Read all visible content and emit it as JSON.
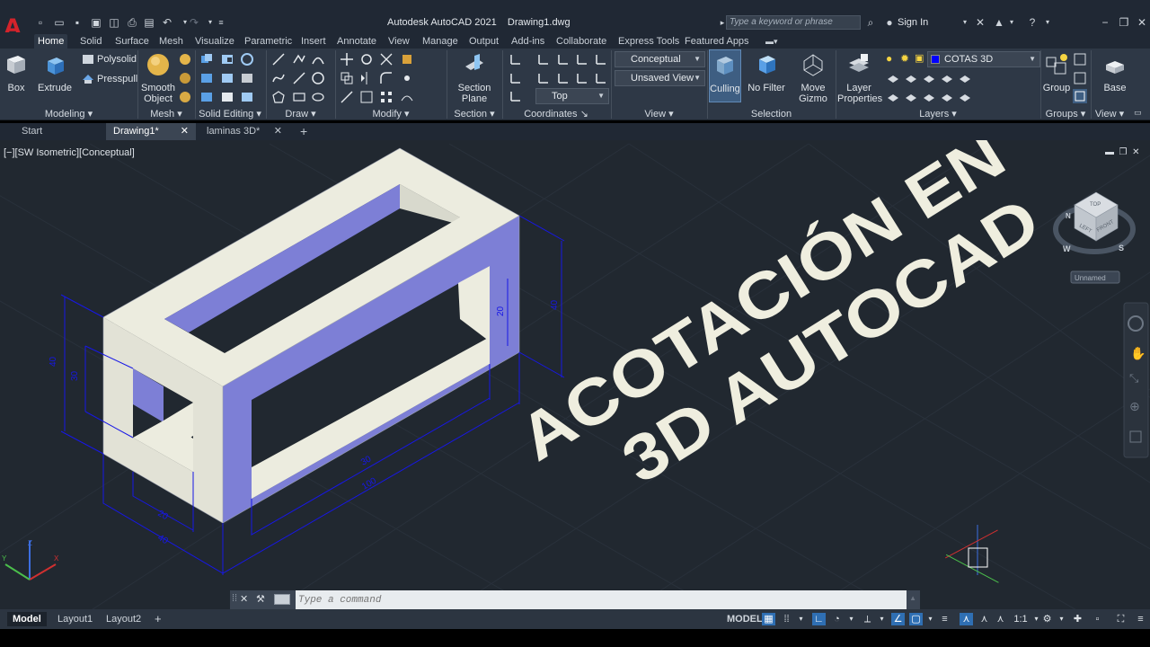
{
  "app": {
    "title": "Autodesk AutoCAD 2021    Drawing1.dwg",
    "search_placeholder": "Type a keyword or phrase",
    "sign_in": "Sign In",
    "logo": "A"
  },
  "ribbon_tabs": [
    "Home",
    "Solid",
    "Surface",
    "Mesh",
    "Visualize",
    "Parametric",
    "Insert",
    "Annotate",
    "View",
    "Manage",
    "Output",
    "Add-ins",
    "Collaborate",
    "Express Tools",
    "Featured Apps"
  ],
  "ribbon": {
    "modeling": {
      "title": "Modeling",
      "box": "Box",
      "extrude": "Extrude",
      "polysolid": "Polysolid",
      "presspull": "Presspull"
    },
    "mesh": {
      "title": "Mesh",
      "smooth": "Smooth",
      "object": "Object"
    },
    "solid_editing": {
      "title": "Solid Editing"
    },
    "draw": {
      "title": "Draw"
    },
    "modify": {
      "title": "Modify"
    },
    "section": {
      "title": "Section",
      "plane_1": "Section",
      "plane_2": "Plane"
    },
    "coordinates": {
      "title": "Coordinates",
      "view_select": "Top"
    },
    "view": {
      "title": "View",
      "visual_style": "Conceptual",
      "saved_view": "Unsaved View"
    },
    "selection": {
      "title": "Selection",
      "culling": "Culling",
      "no_filter": "No Filter",
      "move": "Move",
      "gizmo": "Gizmo"
    },
    "layers": {
      "title": "Layers",
      "layer": "Layer",
      "properties": "Properties",
      "current_layer": "COTAS 3D",
      "current_layer_color": "#0000ff"
    },
    "groups": {
      "title": "Groups",
      "group": "Group"
    },
    "view2": {
      "title": "View",
      "base": "Base"
    }
  },
  "doc_tabs": [
    "Start",
    "Drawing1*",
    "laminas 3D*"
  ],
  "viewport": {
    "label": "[−][SW Isometric][Conceptual]",
    "overlay_line1": "ACOTACIÓN EN",
    "overlay_line2": "3D AUTOCAD",
    "dimensions": [
      "40",
      "30",
      "20",
      "40",
      "30",
      "100",
      "20",
      "40"
    ],
    "viewcube": {
      "top": "TOP",
      "left": "LEFT",
      "front": "FRONT",
      "compass_w": "W",
      "compass_s": "S",
      "compass_n": "N",
      "ucs_name": "Unnamed"
    },
    "ucs": {
      "x": "X",
      "y": "Y",
      "z": "Z"
    }
  },
  "command": {
    "placeholder": "Type a command"
  },
  "status": {
    "layouts": [
      "Model",
      "Layout1",
      "Layout2"
    ],
    "model": "MODEL",
    "scale": "1:1"
  },
  "colors": {
    "viewport_bg": "#212830",
    "object_face_light": "#ececdf",
    "object_face_shade": "#7d7fd6",
    "dimension": "#1717e6",
    "ribbon_bg": "#2e3846",
    "title_bg": "#202834"
  }
}
